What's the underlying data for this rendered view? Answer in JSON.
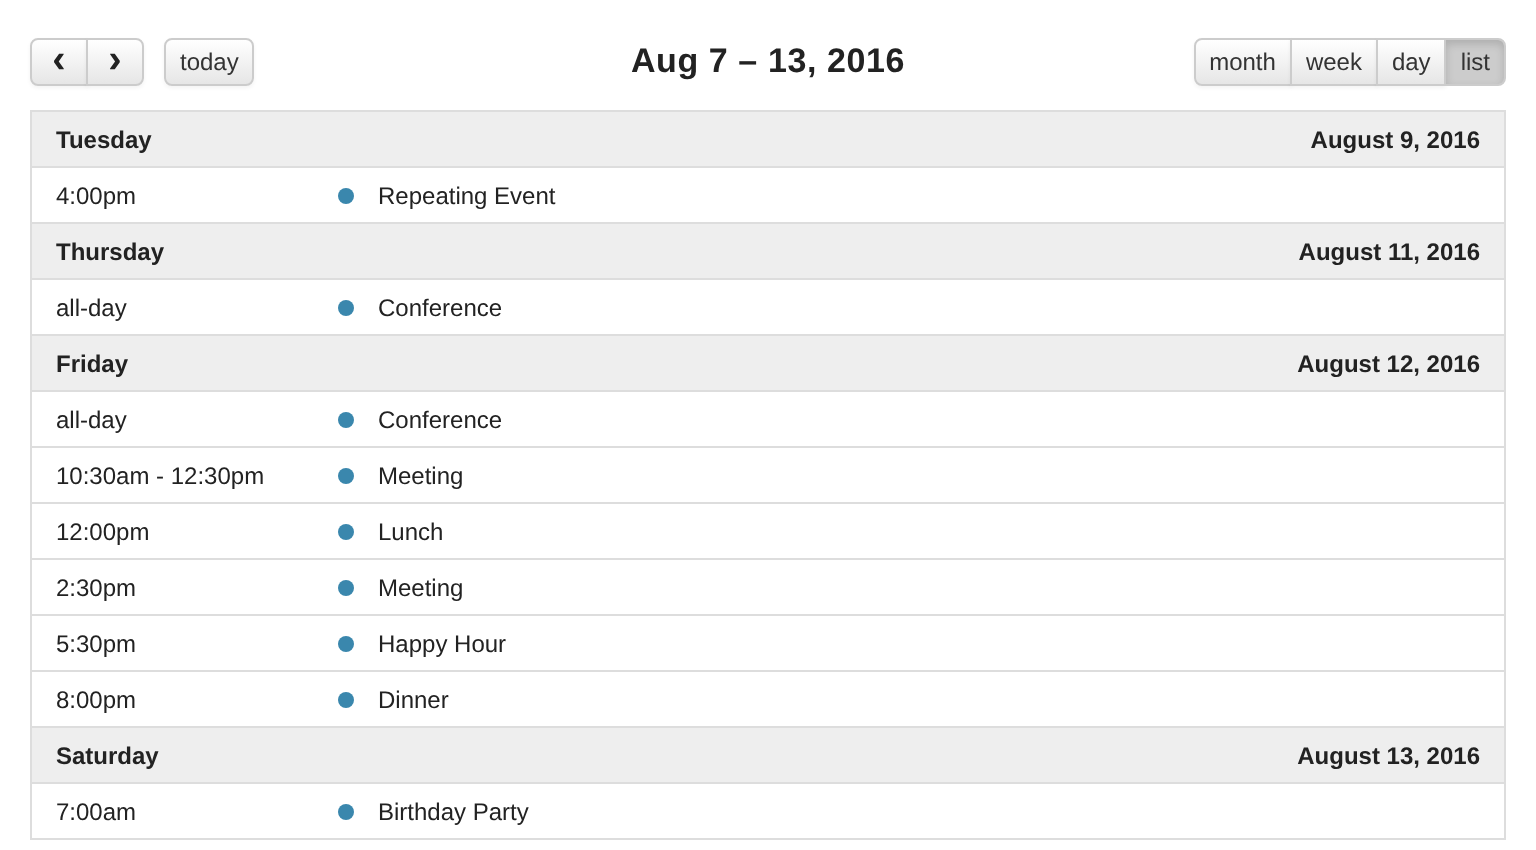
{
  "toolbar": {
    "nav_buttons": [
      "‹",
      "›"
    ],
    "today": "today",
    "title": "Aug 7 – 13, 2016",
    "views": [
      {
        "label": "month",
        "selected": false
      },
      {
        "label": "week",
        "selected": false
      },
      {
        "label": "day",
        "selected": false
      },
      {
        "label": "list",
        "selected": true
      }
    ]
  },
  "days": [
    {
      "weekday": "Tuesday",
      "date": "August 9, 2016",
      "events": [
        {
          "time": "4:00pm",
          "title": "Repeating Event"
        }
      ]
    },
    {
      "weekday": "Thursday",
      "date": "August 11, 2016",
      "events": [
        {
          "time": "all-day",
          "title": "Conference"
        }
      ]
    },
    {
      "weekday": "Friday",
      "date": "August 12, 2016",
      "events": [
        {
          "time": "all-day",
          "title": "Conference"
        },
        {
          "time": "10:30am - 12:30pm",
          "title": "Meeting"
        },
        {
          "time": "12:00pm",
          "title": "Lunch"
        },
        {
          "time": "2:30pm",
          "title": "Meeting"
        },
        {
          "time": "5:30pm",
          "title": "Happy Hour"
        },
        {
          "time": "8:00pm",
          "title": "Dinner"
        }
      ]
    },
    {
      "weekday": "Saturday",
      "date": "August 13, 2016",
      "events": [
        {
          "time": "7:00am",
          "title": "Birthday Party"
        }
      ]
    }
  ]
}
